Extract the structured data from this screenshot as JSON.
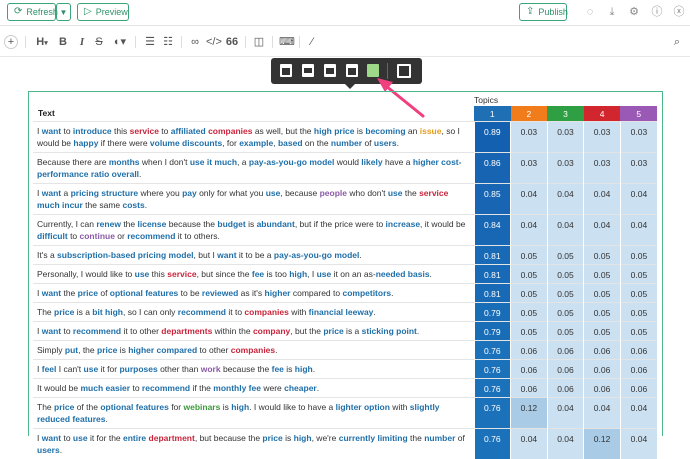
{
  "topbar": {
    "refresh_label": "Refresh",
    "preview_label": "Preview",
    "publish_label": "Publish",
    "icons": [
      "comment-icon",
      "download-icon",
      "gear-icon",
      "info-icon",
      "close-icon"
    ]
  },
  "toolbar": {
    "heading_label": "H",
    "bold": "B",
    "italic": "I",
    "strike": "S",
    "quote": "66"
  },
  "table": {
    "text_header": "Text",
    "topics_header": "Topics",
    "topics": [
      {
        "label": "1",
        "color": "#1f6fb5"
      },
      {
        "label": "2",
        "color": "#f07c1c"
      },
      {
        "label": "3",
        "color": "#2ea043"
      },
      {
        "label": "4",
        "color": "#d1262d"
      },
      {
        "label": "5",
        "color": "#9b59b6"
      }
    ],
    "rows": [
      {
        "segments": [
          [
            "",
            "I "
          ],
          [
            "b",
            "want"
          ],
          [
            "",
            " to "
          ],
          [
            "b",
            "introduce"
          ],
          [
            "",
            " this "
          ],
          [
            "r",
            "service"
          ],
          [
            "",
            " to "
          ],
          [
            "b",
            "affiliated"
          ],
          [
            "",
            " "
          ],
          [
            "r",
            "companies"
          ],
          [
            "",
            " as well, but the "
          ],
          [
            "b",
            "high price"
          ],
          [
            "",
            " is "
          ],
          [
            "b",
            "becoming"
          ],
          [
            "",
            " an "
          ],
          [
            "o",
            "issue"
          ],
          [
            "",
            ", so I would be "
          ],
          [
            "b",
            "happy"
          ],
          [
            "",
            " if there were "
          ],
          [
            "b",
            "volume discounts"
          ],
          [
            "",
            ", for "
          ],
          [
            "b",
            "example"
          ],
          [
            "",
            ", "
          ],
          [
            "b",
            "based"
          ],
          [
            "",
            " on the "
          ],
          [
            "b",
            "number"
          ],
          [
            "",
            " of "
          ],
          [
            "b",
            "users"
          ],
          [
            "",
            "."
          ]
        ],
        "values": [
          "0.89",
          "0.03",
          "0.03",
          "0.03",
          "0.03"
        ]
      },
      {
        "segments": [
          [
            "",
            "Because there are "
          ],
          [
            "b",
            "months"
          ],
          [
            "",
            " when I don't "
          ],
          [
            "b",
            "use it much"
          ],
          [
            "",
            ", a "
          ],
          [
            "b",
            "pay-as-you-go model"
          ],
          [
            "",
            " would "
          ],
          [
            "b",
            "likely"
          ],
          [
            "",
            " have a "
          ],
          [
            "b",
            "higher cost-performance ratio overall"
          ],
          [
            "",
            "."
          ]
        ],
        "values": [
          "0.86",
          "0.03",
          "0.03",
          "0.03",
          "0.03"
        ]
      },
      {
        "segments": [
          [
            "",
            "I "
          ],
          [
            "b",
            "want"
          ],
          [
            "",
            " a "
          ],
          [
            "b",
            "pricing structure"
          ],
          [
            "",
            " where you "
          ],
          [
            "b",
            "pay"
          ],
          [
            "",
            " only for what you "
          ],
          [
            "b",
            "use"
          ],
          [
            "",
            ", because "
          ],
          [
            "p",
            "people"
          ],
          [
            "",
            " who don't "
          ],
          [
            "b",
            "use"
          ],
          [
            "",
            " the "
          ],
          [
            "r",
            "service"
          ],
          [
            "",
            " "
          ],
          [
            "b",
            "much incur"
          ],
          [
            "",
            " the same "
          ],
          [
            "b",
            "costs"
          ],
          [
            "",
            "."
          ]
        ],
        "values": [
          "0.85",
          "0.04",
          "0.04",
          "0.04",
          "0.04"
        ]
      },
      {
        "segments": [
          [
            "",
            "Currently, I can "
          ],
          [
            "b",
            "renew"
          ],
          [
            "",
            " the "
          ],
          [
            "b",
            "license"
          ],
          [
            "",
            " because the "
          ],
          [
            "b",
            "budget"
          ],
          [
            "",
            " is "
          ],
          [
            "b",
            "abundant"
          ],
          [
            "",
            ", but if the price were to "
          ],
          [
            "b",
            "increase"
          ],
          [
            "",
            ", it would be "
          ],
          [
            "b",
            "difficult"
          ],
          [
            "",
            " to "
          ],
          [
            "p",
            "continue"
          ],
          [
            "",
            " or "
          ],
          [
            "b",
            "recommend"
          ],
          [
            "",
            " it to others."
          ]
        ],
        "values": [
          "0.84",
          "0.04",
          "0.04",
          "0.04",
          "0.04"
        ]
      },
      {
        "segments": [
          [
            "",
            "It's a "
          ],
          [
            "b",
            "subscription-based pricing model"
          ],
          [
            "",
            ", but I "
          ],
          [
            "b",
            "want"
          ],
          [
            "",
            " it to be a "
          ],
          [
            "b",
            "pay-as-you-go model"
          ],
          [
            "",
            "."
          ]
        ],
        "values": [
          "0.81",
          "0.05",
          "0.05",
          "0.05",
          "0.05"
        ]
      },
      {
        "segments": [
          [
            "",
            "Personally, I would like to "
          ],
          [
            "b",
            "use"
          ],
          [
            "",
            " this "
          ],
          [
            "r",
            "service"
          ],
          [
            "",
            ", but since the "
          ],
          [
            "b",
            "fee"
          ],
          [
            "",
            " is too "
          ],
          [
            "b",
            "high"
          ],
          [
            "",
            ", I "
          ],
          [
            "b",
            "use"
          ],
          [
            "",
            " it on an as-"
          ],
          [
            "b",
            "needed basis"
          ],
          [
            "",
            "."
          ]
        ],
        "values": [
          "0.81",
          "0.05",
          "0.05",
          "0.05",
          "0.05"
        ]
      },
      {
        "segments": [
          [
            "",
            "I "
          ],
          [
            "b",
            "want"
          ],
          [
            "",
            " the "
          ],
          [
            "b",
            "price"
          ],
          [
            "",
            " of "
          ],
          [
            "b",
            "optional features"
          ],
          [
            "",
            " to be "
          ],
          [
            "b",
            "reviewed"
          ],
          [
            "",
            " as it's "
          ],
          [
            "b",
            "higher"
          ],
          [
            "",
            " compared to "
          ],
          [
            "b",
            "competitors"
          ],
          [
            "",
            "."
          ]
        ],
        "values": [
          "0.81",
          "0.05",
          "0.05",
          "0.05",
          "0.05"
        ]
      },
      {
        "segments": [
          [
            "",
            "The "
          ],
          [
            "b",
            "price"
          ],
          [
            "",
            " is a "
          ],
          [
            "b",
            "bit high"
          ],
          [
            "",
            ", so I can only "
          ],
          [
            "b",
            "recommend"
          ],
          [
            "",
            " it to "
          ],
          [
            "r",
            "companies"
          ],
          [
            "",
            " with "
          ],
          [
            "b",
            "financial leeway"
          ],
          [
            "",
            "."
          ]
        ],
        "values": [
          "0.79",
          "0.05",
          "0.05",
          "0.05",
          "0.05"
        ]
      },
      {
        "segments": [
          [
            "",
            "I "
          ],
          [
            "b",
            "want"
          ],
          [
            "",
            " to "
          ],
          [
            "b",
            "recommend"
          ],
          [
            "",
            " it to other "
          ],
          [
            "r",
            "departments"
          ],
          [
            "",
            " within the "
          ],
          [
            "r",
            "company"
          ],
          [
            "",
            ", but the "
          ],
          [
            "b",
            "price"
          ],
          [
            "",
            " is a "
          ],
          [
            "b",
            "sticking point"
          ],
          [
            "",
            "."
          ]
        ],
        "values": [
          "0.79",
          "0.05",
          "0.05",
          "0.05",
          "0.05"
        ]
      },
      {
        "segments": [
          [
            "",
            "Simply "
          ],
          [
            "b",
            "put"
          ],
          [
            "",
            ", the "
          ],
          [
            "b",
            "price"
          ],
          [
            "",
            " is "
          ],
          [
            "b",
            "higher compared"
          ],
          [
            "",
            " to other "
          ],
          [
            "r",
            "companies"
          ],
          [
            "",
            "."
          ]
        ],
        "values": [
          "0.76",
          "0.06",
          "0.06",
          "0.06",
          "0.06"
        ]
      },
      {
        "segments": [
          [
            "",
            "I "
          ],
          [
            "b",
            "feel"
          ],
          [
            "",
            " I can't "
          ],
          [
            "b",
            "use"
          ],
          [
            "",
            " it for "
          ],
          [
            "b",
            "purposes"
          ],
          [
            "",
            " other than "
          ],
          [
            "p",
            "work"
          ],
          [
            "",
            " because the "
          ],
          [
            "b",
            "fee"
          ],
          [
            "",
            " is "
          ],
          [
            "b",
            "high"
          ],
          [
            "",
            "."
          ]
        ],
        "values": [
          "0.76",
          "0.06",
          "0.06",
          "0.06",
          "0.06"
        ]
      },
      {
        "segments": [
          [
            "",
            "It would be "
          ],
          [
            "b",
            "much easier"
          ],
          [
            "",
            " to "
          ],
          [
            "b",
            "recommend"
          ],
          [
            "",
            " if the "
          ],
          [
            "b",
            "monthly fee"
          ],
          [
            "",
            " were "
          ],
          [
            "b",
            "cheaper"
          ],
          [
            "",
            "."
          ]
        ],
        "values": [
          "0.76",
          "0.06",
          "0.06",
          "0.06",
          "0.06"
        ]
      },
      {
        "segments": [
          [
            "",
            "The "
          ],
          [
            "b",
            "price"
          ],
          [
            "",
            " of the "
          ],
          [
            "b",
            "optional features"
          ],
          [
            "",
            " for "
          ],
          [
            "g",
            "webinars"
          ],
          [
            "",
            " is "
          ],
          [
            "b",
            "high"
          ],
          [
            "",
            ". I would like to have a "
          ],
          [
            "b",
            "lighter option"
          ],
          [
            "",
            " with "
          ],
          [
            "b",
            "slightly reduced features"
          ],
          [
            "",
            "."
          ]
        ],
        "values": [
          "0.76",
          "0.12",
          "0.04",
          "0.04",
          "0.04"
        ]
      },
      {
        "segments": [
          [
            "",
            "I "
          ],
          [
            "b",
            "want"
          ],
          [
            "",
            " to "
          ],
          [
            "b",
            "use"
          ],
          [
            "",
            " it for the "
          ],
          [
            "b",
            "entire"
          ],
          [
            "",
            " "
          ],
          [
            "r",
            "department"
          ],
          [
            "",
            ", but because the "
          ],
          [
            "b",
            "price"
          ],
          [
            "",
            " is "
          ],
          [
            "b",
            "high"
          ],
          [
            "",
            ", we're "
          ],
          [
            "b",
            "currently limiting"
          ],
          [
            "",
            " the "
          ],
          [
            "b",
            "number"
          ],
          [
            "",
            " of "
          ],
          [
            "b",
            "users"
          ],
          [
            "",
            "."
          ]
        ],
        "values": [
          "0.76",
          "0.04",
          "0.04",
          "0.12",
          "0.04"
        ]
      }
    ]
  }
}
